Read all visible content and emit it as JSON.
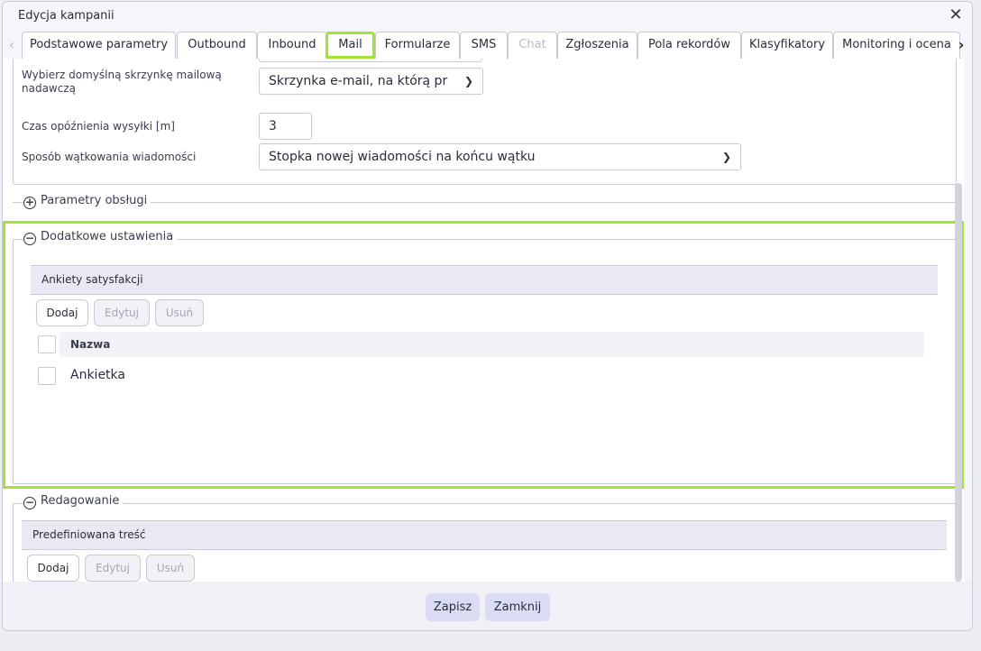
{
  "dialog": {
    "title": "Edycja kampanii"
  },
  "tabs": [
    {
      "label": "Podstawowe parametry",
      "state": "normal"
    },
    {
      "label": "Outbound",
      "state": "normal"
    },
    {
      "label": "Inbound",
      "state": "normal"
    },
    {
      "label": "Mail",
      "state": "active"
    },
    {
      "label": "Formularze",
      "state": "normal"
    },
    {
      "label": "SMS",
      "state": "normal"
    },
    {
      "label": "Chat",
      "state": "disabled"
    },
    {
      "label": "Zgłoszenia",
      "state": "normal"
    },
    {
      "label": "Pola rekordów",
      "state": "normal"
    },
    {
      "label": "Klasyfikatory",
      "state": "normal"
    },
    {
      "label": "Monitoring i ocena",
      "state": "normal"
    }
  ],
  "mail": {
    "mailbox_label": "Wybierz domyślną skrzynkę mailową nadawczą",
    "mailbox_value": "Skrzynka e-mail,  na którą pr",
    "delay_label": "Czas opóźnienia wysyłki [m]",
    "delay_value": "3",
    "threading_label": "Sposób wątkowania wiadomości",
    "threading_value": "Stopka nowej wiadomości na końcu wątku"
  },
  "sections": {
    "handling": "Parametry obsługi",
    "additional": "Dodatkowe ustawienia",
    "editing": "Redagowanie"
  },
  "surveys": {
    "header": "Ankiety satysfakcji",
    "add": "Dodaj",
    "edit": "Edytuj",
    "delete": "Usuń",
    "column_name": "Nazwa",
    "rows": [
      "Ankietka"
    ]
  },
  "predefined": {
    "header": "Predefiniowana treść",
    "add": "Dodaj",
    "edit": "Edytuj",
    "delete": "Usuń"
  },
  "footer": {
    "save": "Zapisz",
    "close": "Zamknij"
  }
}
